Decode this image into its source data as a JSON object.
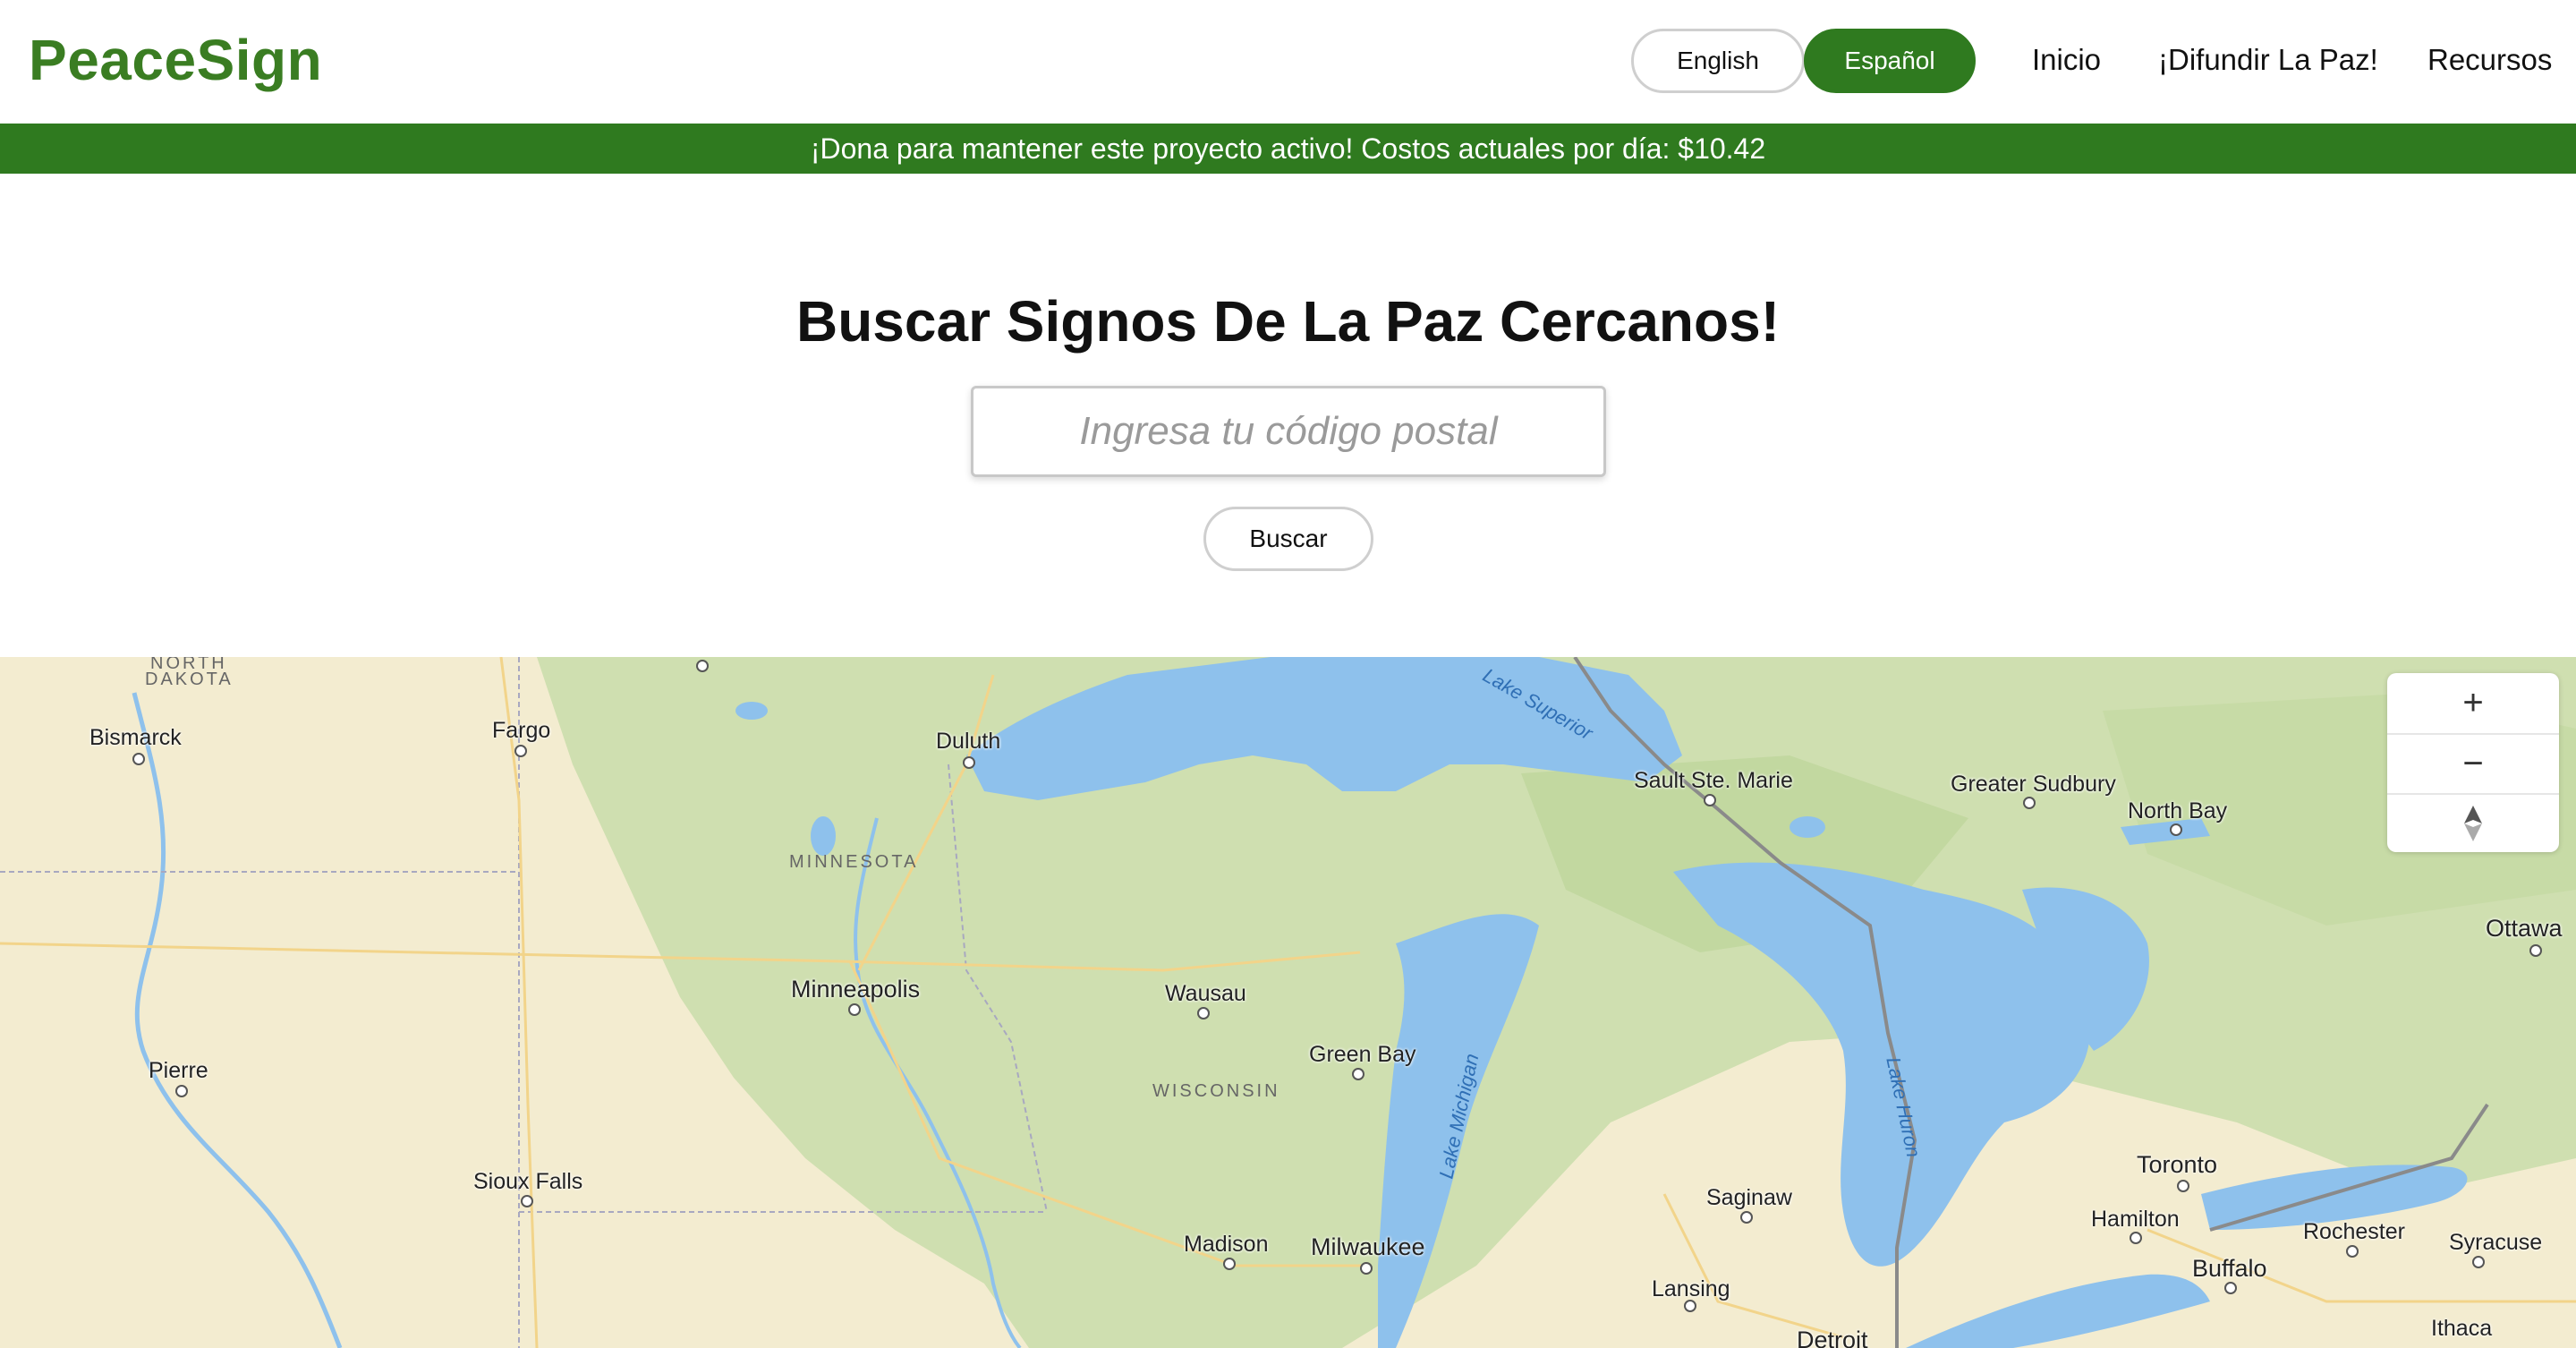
{
  "header": {
    "logo": "PeaceSign",
    "lang_english": "English",
    "lang_espanol": "Español",
    "nav": {
      "inicio": "Inicio",
      "difundir": "¡Difundir La Paz!",
      "recursos": "Recursos"
    }
  },
  "banner": {
    "text": "¡Dona para mantener este proyecto activo! Costos actuales por día: $10.42"
  },
  "search": {
    "title": "Buscar Signos De La Paz Cercanos!",
    "placeholder": "Ingresa tu código postal",
    "button": "Buscar"
  },
  "map": {
    "cities": {
      "bismarck": "Bismarck",
      "fargo": "Fargo",
      "duluth": "Duluth",
      "sault": "Sault Ste. Marie",
      "sudbury": "Greater Sudbury",
      "northbay": "North Bay",
      "ottawa": "Ottawa",
      "minneapolis": "Minneapolis",
      "wausau": "Wausau",
      "greenbay": "Green Bay",
      "pierre": "Pierre",
      "siouxfalls": "Sioux Falls",
      "madison": "Madison",
      "milwaukee": "Milwaukee",
      "saginaw": "Saginaw",
      "lansing": "Lansing",
      "detroit": "Detroit",
      "toronto": "Toronto",
      "hamilton": "Hamilton",
      "rochester": "Rochester",
      "buffalo": "Buffalo",
      "syracuse": "Syracuse",
      "ithaca": "Ithaca"
    },
    "states": {
      "nd_1": "NORTH",
      "nd_2": "DAKOTA",
      "mn": "MINNESOTA",
      "wi": "WISCONSIN"
    },
    "water": {
      "superior": "Lake Superior",
      "michigan": "Lake Michigan",
      "huron": "Lake Huron"
    },
    "controls": {
      "zoom_in": "+",
      "zoom_out": "−",
      "compass_icon": "compass-icon"
    },
    "colors": {
      "water": "#8ec1ec",
      "land": "#f3ecd0",
      "forest": "#cfdfb0"
    }
  },
  "colors": {
    "brand_green": "#3a7d22",
    "banner_green": "#2f7a1f"
  }
}
